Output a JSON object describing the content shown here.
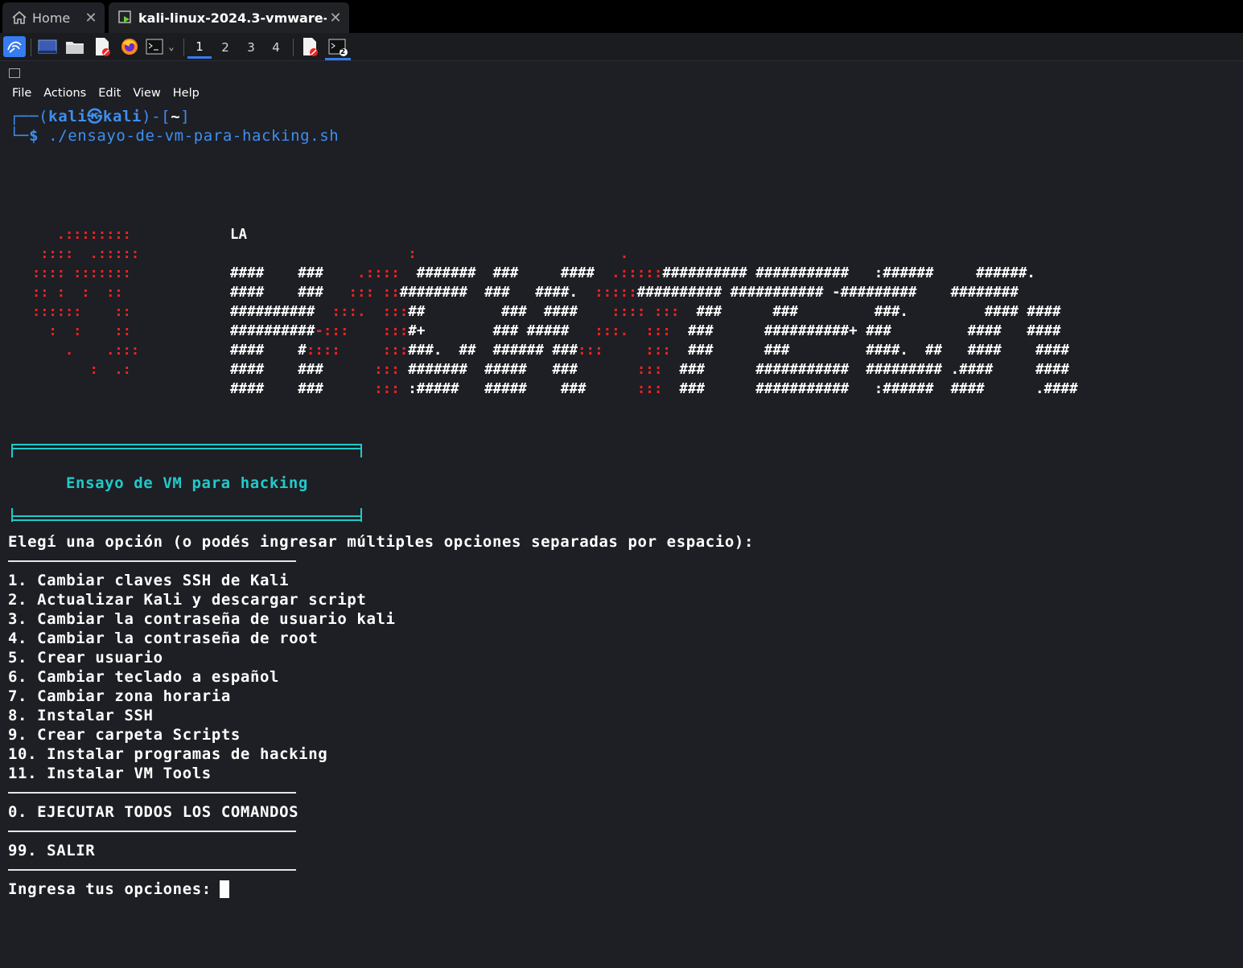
{
  "tabs": [
    {
      "label": "Home",
      "icon": "home-icon"
    },
    {
      "label": "kali-linux-2024.3-vmware-...",
      "icon": "vm-icon"
    }
  ],
  "panel": {
    "workspaces": [
      "1",
      "2",
      "3",
      "4"
    ],
    "active_workspace": "1",
    "terminal_badge": "2"
  },
  "menu": [
    "File",
    "Actions",
    "Edit",
    "View",
    "Help"
  ],
  "prompt": {
    "open": "┌──(",
    "user": "kali㉿kali",
    "close": ")-[",
    "dir": "~",
    "end": "]",
    "dollar_prefix": "└─",
    "dollar": "$",
    "command": " ./ensayo-de-vm-para-hacking.sh"
  },
  "banner": {
    "top_label": "LA",
    "box_title": "Ensayo de VM para hacking"
  },
  "menu_prompt": "Elegí una opción (o podés ingresar múltiples opciones separadas por espacio):",
  "options": [
    "1. Cambiar claves SSH de Kali",
    "2. Actualizar Kali y descargar script",
    "3. Cambiar la contraseña de usuario kali",
    "4. Cambiar la contraseña de root",
    "5. Crear usuario",
    "6. Cambiar teclado a español",
    "7. Cambiar zona horaria",
    "8. Instalar SSH",
    "9. Crear carpeta Scripts",
    "10. Instalar programas de hacking",
    "11. Instalar VM Tools"
  ],
  "run_all": "0. EJECUTAR TODOS LOS COMANDOS",
  "exit": "99. SALIR",
  "input_prompt": "Ingresa tus opciones: ",
  "colors": {
    "accent_blue": "#367bf0",
    "prompt_blue": "#3f8ef0",
    "cyan": "#21c9c9",
    "red": "#ff2020",
    "background": "#1d1f24"
  }
}
